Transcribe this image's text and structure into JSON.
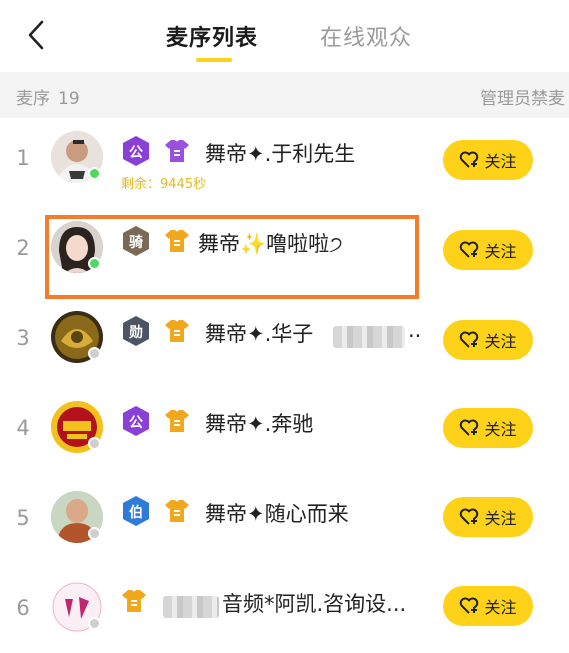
{
  "header": {
    "tabs": [
      {
        "label": "麦序列表",
        "active": true
      },
      {
        "label": "在线观众",
        "active": false
      }
    ]
  },
  "subbar": {
    "title": "麦序",
    "count": "19",
    "right_label": "管理员禁麦"
  },
  "colors": {
    "accent": "#ffd21a",
    "highlight": "#f57c2a",
    "online": "#4cd964",
    "offline": "#cfcfcf"
  },
  "rows": [
    {
      "index": "1",
      "level_icon": "公",
      "level_color": "#8a3fd8",
      "shirt_color": "#9b4fe0",
      "name": "舞帝✦.于利先生",
      "remain": "剩余：9445秒",
      "online": true,
      "follow": "关注"
    },
    {
      "index": "2",
      "level_icon": "骑",
      "level_color": "#7a6a55",
      "shirt_color": "#f2a81d",
      "name": "舞帝✨噜啦啦੭",
      "online": true,
      "follow": "关注"
    },
    {
      "index": "3",
      "level_icon": "勋",
      "level_color": "#4b5563",
      "shirt_color": "#f2a81d",
      "name": "舞帝✦.华子",
      "suffix": "..",
      "online": false,
      "follow": "关注"
    },
    {
      "index": "4",
      "level_icon": "公",
      "level_color": "#8a3fd8",
      "shirt_color": "#f2a81d",
      "name": "舞帝✦.奔驰",
      "online": false,
      "follow": "关注"
    },
    {
      "index": "5",
      "level_icon": "伯",
      "level_color": "#2f7bd8",
      "shirt_color": "#f2a81d",
      "name": "舞帝✦随心而来",
      "online": false,
      "follow": "关注"
    },
    {
      "index": "6",
      "shirt_color": "#f2a81d",
      "name": "音频*阿凯.咨询设...",
      "online": false,
      "follow": "关注"
    }
  ]
}
